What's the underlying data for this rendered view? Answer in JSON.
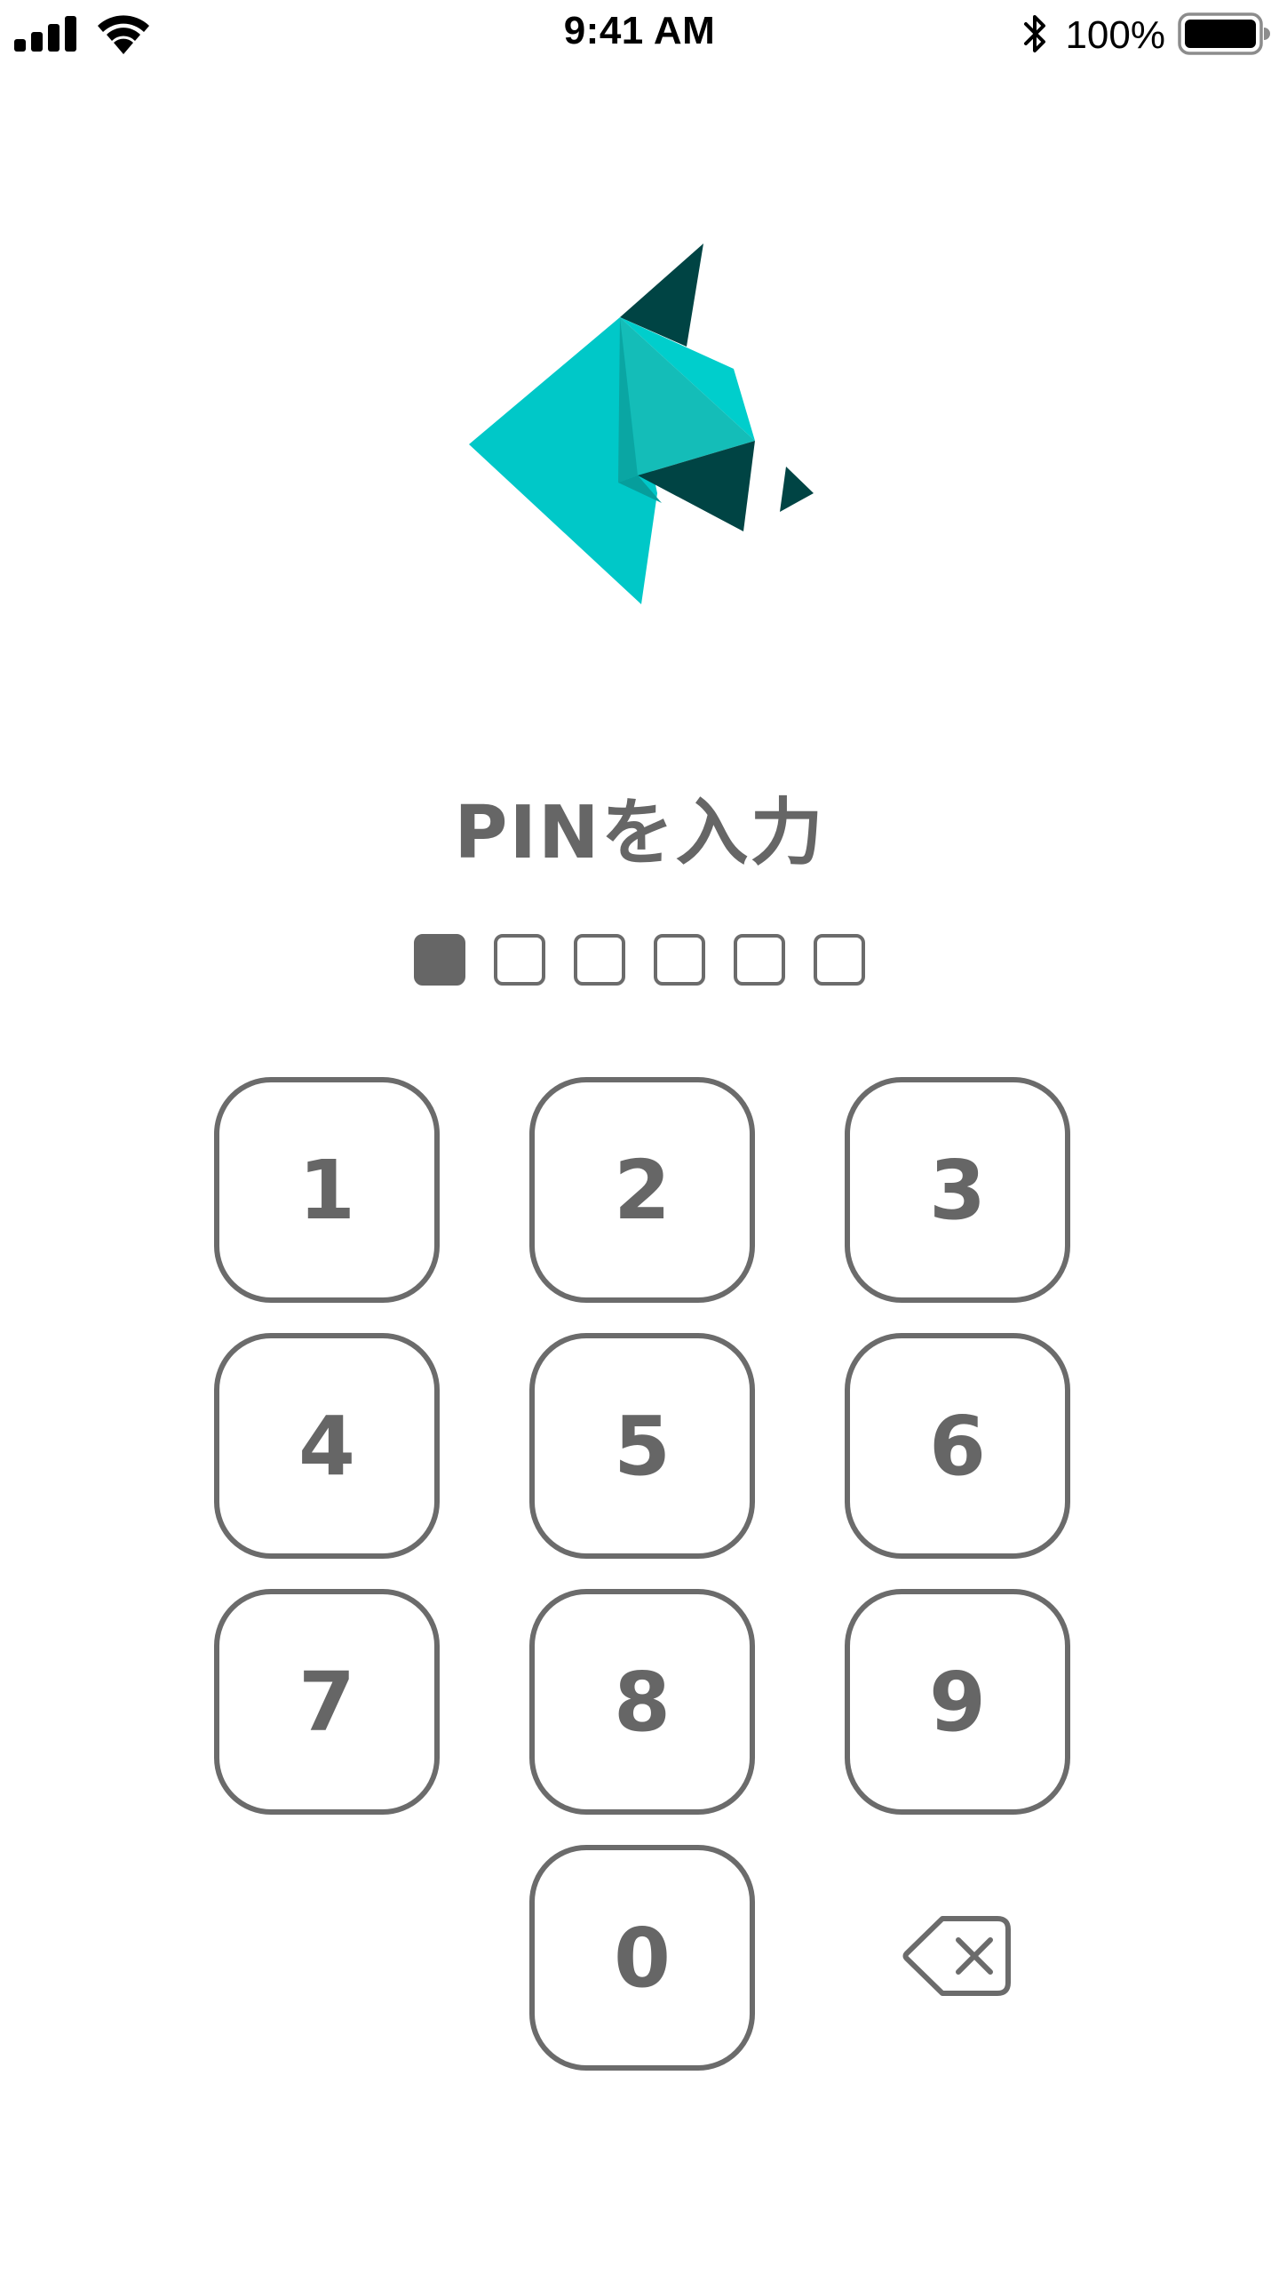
{
  "status_bar": {
    "time": "9:41 AM",
    "battery_percent": "100%",
    "battery_level": 1.0,
    "icons": [
      "signal-icon",
      "wifi-icon",
      "bluetooth-icon",
      "battery-icon"
    ]
  },
  "logo": {
    "name": "origami-bird-logo",
    "colors": {
      "turquoise": "#00C8C8",
      "teal_mid": "#14BDB8",
      "teal_shadow": "#0AA6A3",
      "dark_teal": "#004444"
    }
  },
  "pin": {
    "title": "PINを入力",
    "length": 6,
    "entered": 1,
    "colors": {
      "filled": "#666666",
      "empty_border": "#6B6B6B"
    }
  },
  "keypad": {
    "keys": [
      "1",
      "2",
      "3",
      "4",
      "5",
      "6",
      "7",
      "8",
      "9",
      "0"
    ],
    "delete_icon": "backspace-icon",
    "text_color": "#666666",
    "border_color": "#6B6B6B"
  }
}
